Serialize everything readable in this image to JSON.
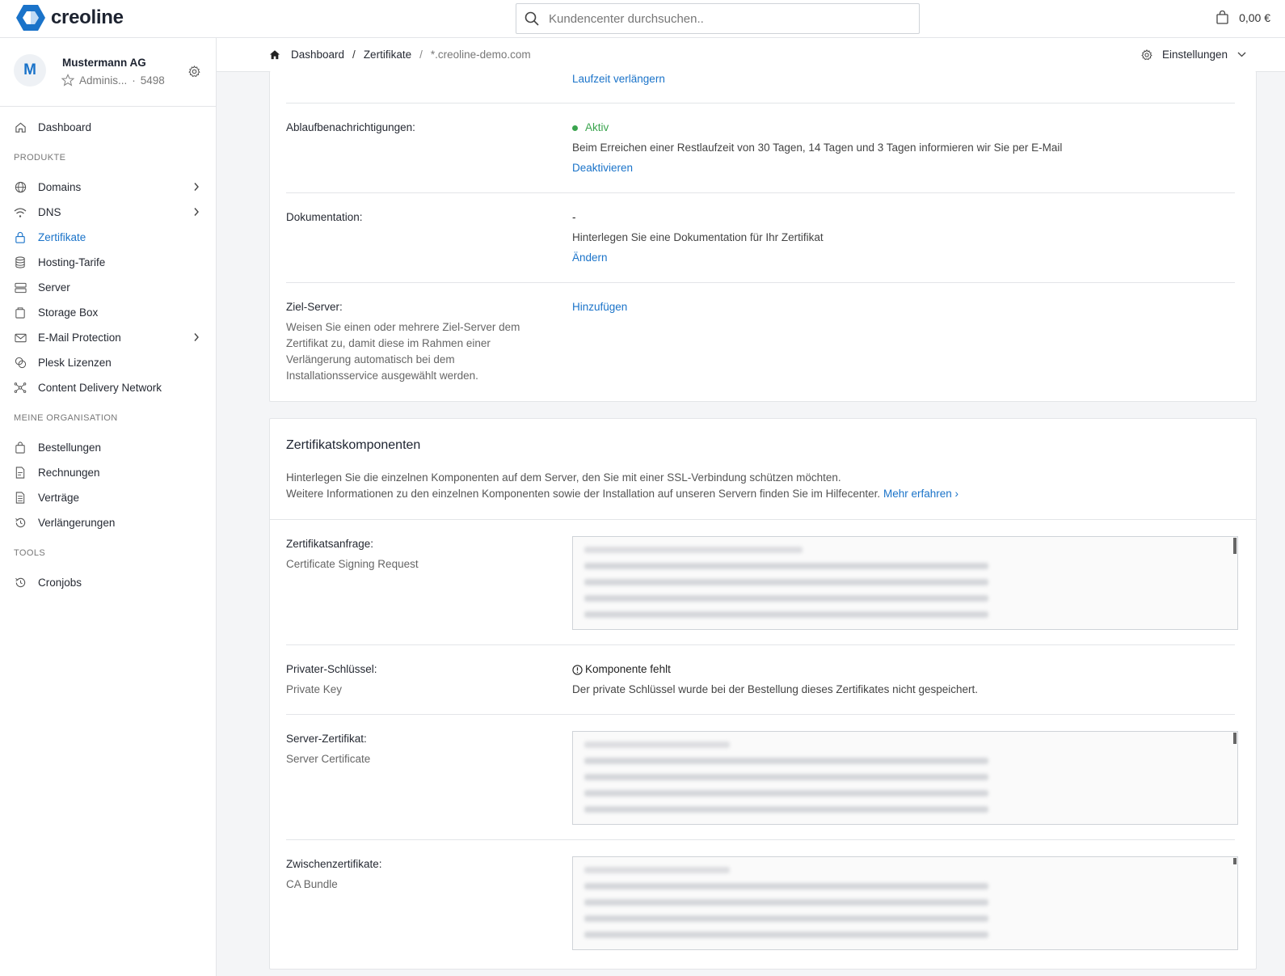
{
  "header": {
    "logo_text": "creoline",
    "search_placeholder": "Kundencenter durchsuchen..",
    "cart_total": "0,00 €",
    "brand_color": "#1a73c9"
  },
  "account": {
    "avatar_letter": "M",
    "name": "Mustermann AG",
    "role": "Adminis...",
    "separator": "·",
    "customer_number": "5498"
  },
  "sidebar": {
    "dashboard": "Dashboard",
    "section_products": "PRODUKTE",
    "products": [
      {
        "label": "Domains",
        "icon": "globe-icon",
        "chevron": true
      },
      {
        "label": "DNS",
        "icon": "wifi-icon",
        "chevron": true
      },
      {
        "label": "Zertifikate",
        "icon": "lock-icon",
        "active": true
      },
      {
        "label": "Hosting-Tarife",
        "icon": "database-icon"
      },
      {
        "label": "Server",
        "icon": "server-icon"
      },
      {
        "label": "Storage Box",
        "icon": "box-icon"
      },
      {
        "label": "E-Mail Protection",
        "icon": "mail-icon",
        "chevron": true
      },
      {
        "label": "Plesk Lizenzen",
        "icon": "plesk-icon"
      },
      {
        "label": "Content Delivery Network",
        "icon": "network-icon"
      }
    ],
    "section_org": "MEINE ORGANISATION",
    "org": [
      {
        "label": "Bestellungen",
        "icon": "bag-icon"
      },
      {
        "label": "Rechnungen",
        "icon": "invoice-icon"
      },
      {
        "label": "Verträge",
        "icon": "contract-icon"
      },
      {
        "label": "Verlängerungen",
        "icon": "history-icon"
      }
    ],
    "section_tools": "TOOLS",
    "tools": [
      {
        "label": "Cronjobs",
        "icon": "history-icon"
      }
    ]
  },
  "breadcrumb": {
    "items": [
      "Dashboard",
      "Zertifikate",
      "*.creoline-demo.com"
    ],
    "separator": "/",
    "settings_label": "Einstellungen"
  },
  "details": {
    "extend_link": "Laufzeit verlängern",
    "notifications": {
      "label": "Ablaufbenachrichtigungen:",
      "status": "Aktiv",
      "description": "Beim Erreichen einer Restlaufzeit von 30 Tagen, 14 Tagen und 3 Tagen informieren wir Sie per E-Mail",
      "action": "Deaktivieren"
    },
    "documentation": {
      "label": "Dokumentation:",
      "value": "-",
      "description": "Hinterlegen Sie eine Dokumentation für Ihr Zertifikat",
      "action": "Ändern"
    },
    "target_server": {
      "label": "Ziel-Server:",
      "description_lines": [
        "Weisen Sie einen oder mehrere Ziel-Server dem",
        "Zertifikat zu, damit diese im Rahmen einer",
        "Verlängerung automatisch bei dem",
        "Installationsservice ausgewählt werden."
      ],
      "action": "Hinzufügen"
    }
  },
  "components": {
    "title": "Zertifikatskomponenten",
    "description_line1": "Hinterlegen Sie die einzelnen Komponenten auf dem Server, den Sie mit einer SSL-Verbindung schützen möchten.",
    "description_line2": "Weitere Informationen zu den einzelnen Komponenten sowie der Installation auf unseren Servern finden Sie im Hilfecenter.",
    "more_link": "Mehr erfahren ›",
    "csr": {
      "label": "Zertifikatsanfrage:",
      "sublabel": "Certificate Signing Request"
    },
    "private_key": {
      "label": "Privater-Schlüssel:",
      "sublabel": "Private Key",
      "status": "Komponente fehlt",
      "description": "Der private Schlüssel wurde bei der Bestellung dieses Zertifikates nicht gespeichert."
    },
    "server_cert": {
      "label": "Server-Zertifikat:",
      "sublabel": "Server Certificate"
    },
    "ca_bundle": {
      "label": "Zwischenzertifikate:",
      "sublabel": "CA Bundle"
    }
  }
}
